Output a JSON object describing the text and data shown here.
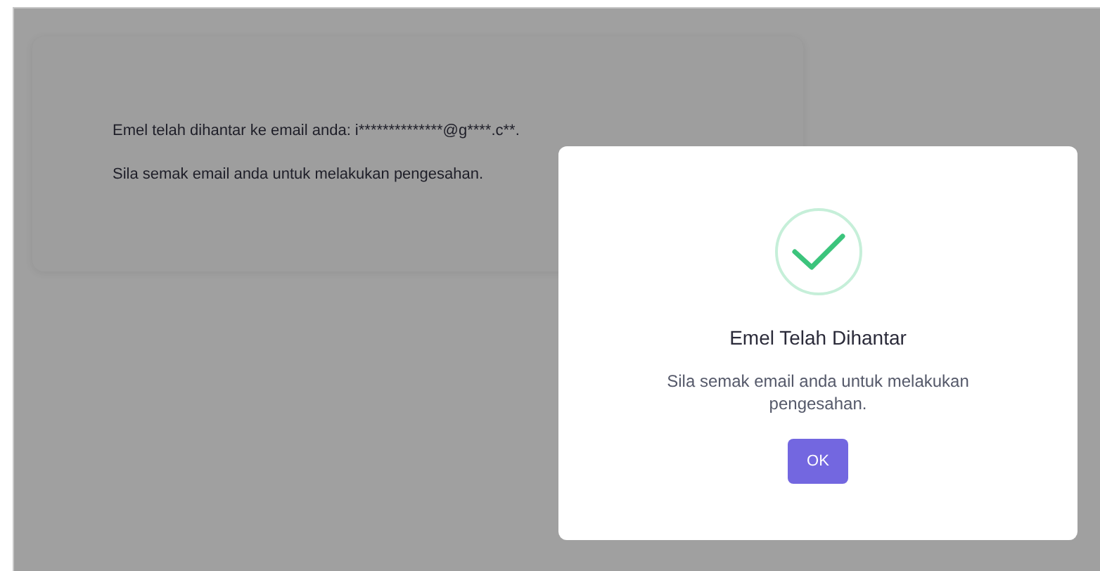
{
  "card": {
    "lines": [
      "Emel telah dihantar ke email anda: i**************@g****.c**.",
      "Sila semak email anda untuk melakukan pengesahan."
    ]
  },
  "dialog": {
    "title": "Emel Telah Dihantar",
    "message": "Sila semak email anda untuk melakukan pengesahan.",
    "button": "OK"
  }
}
